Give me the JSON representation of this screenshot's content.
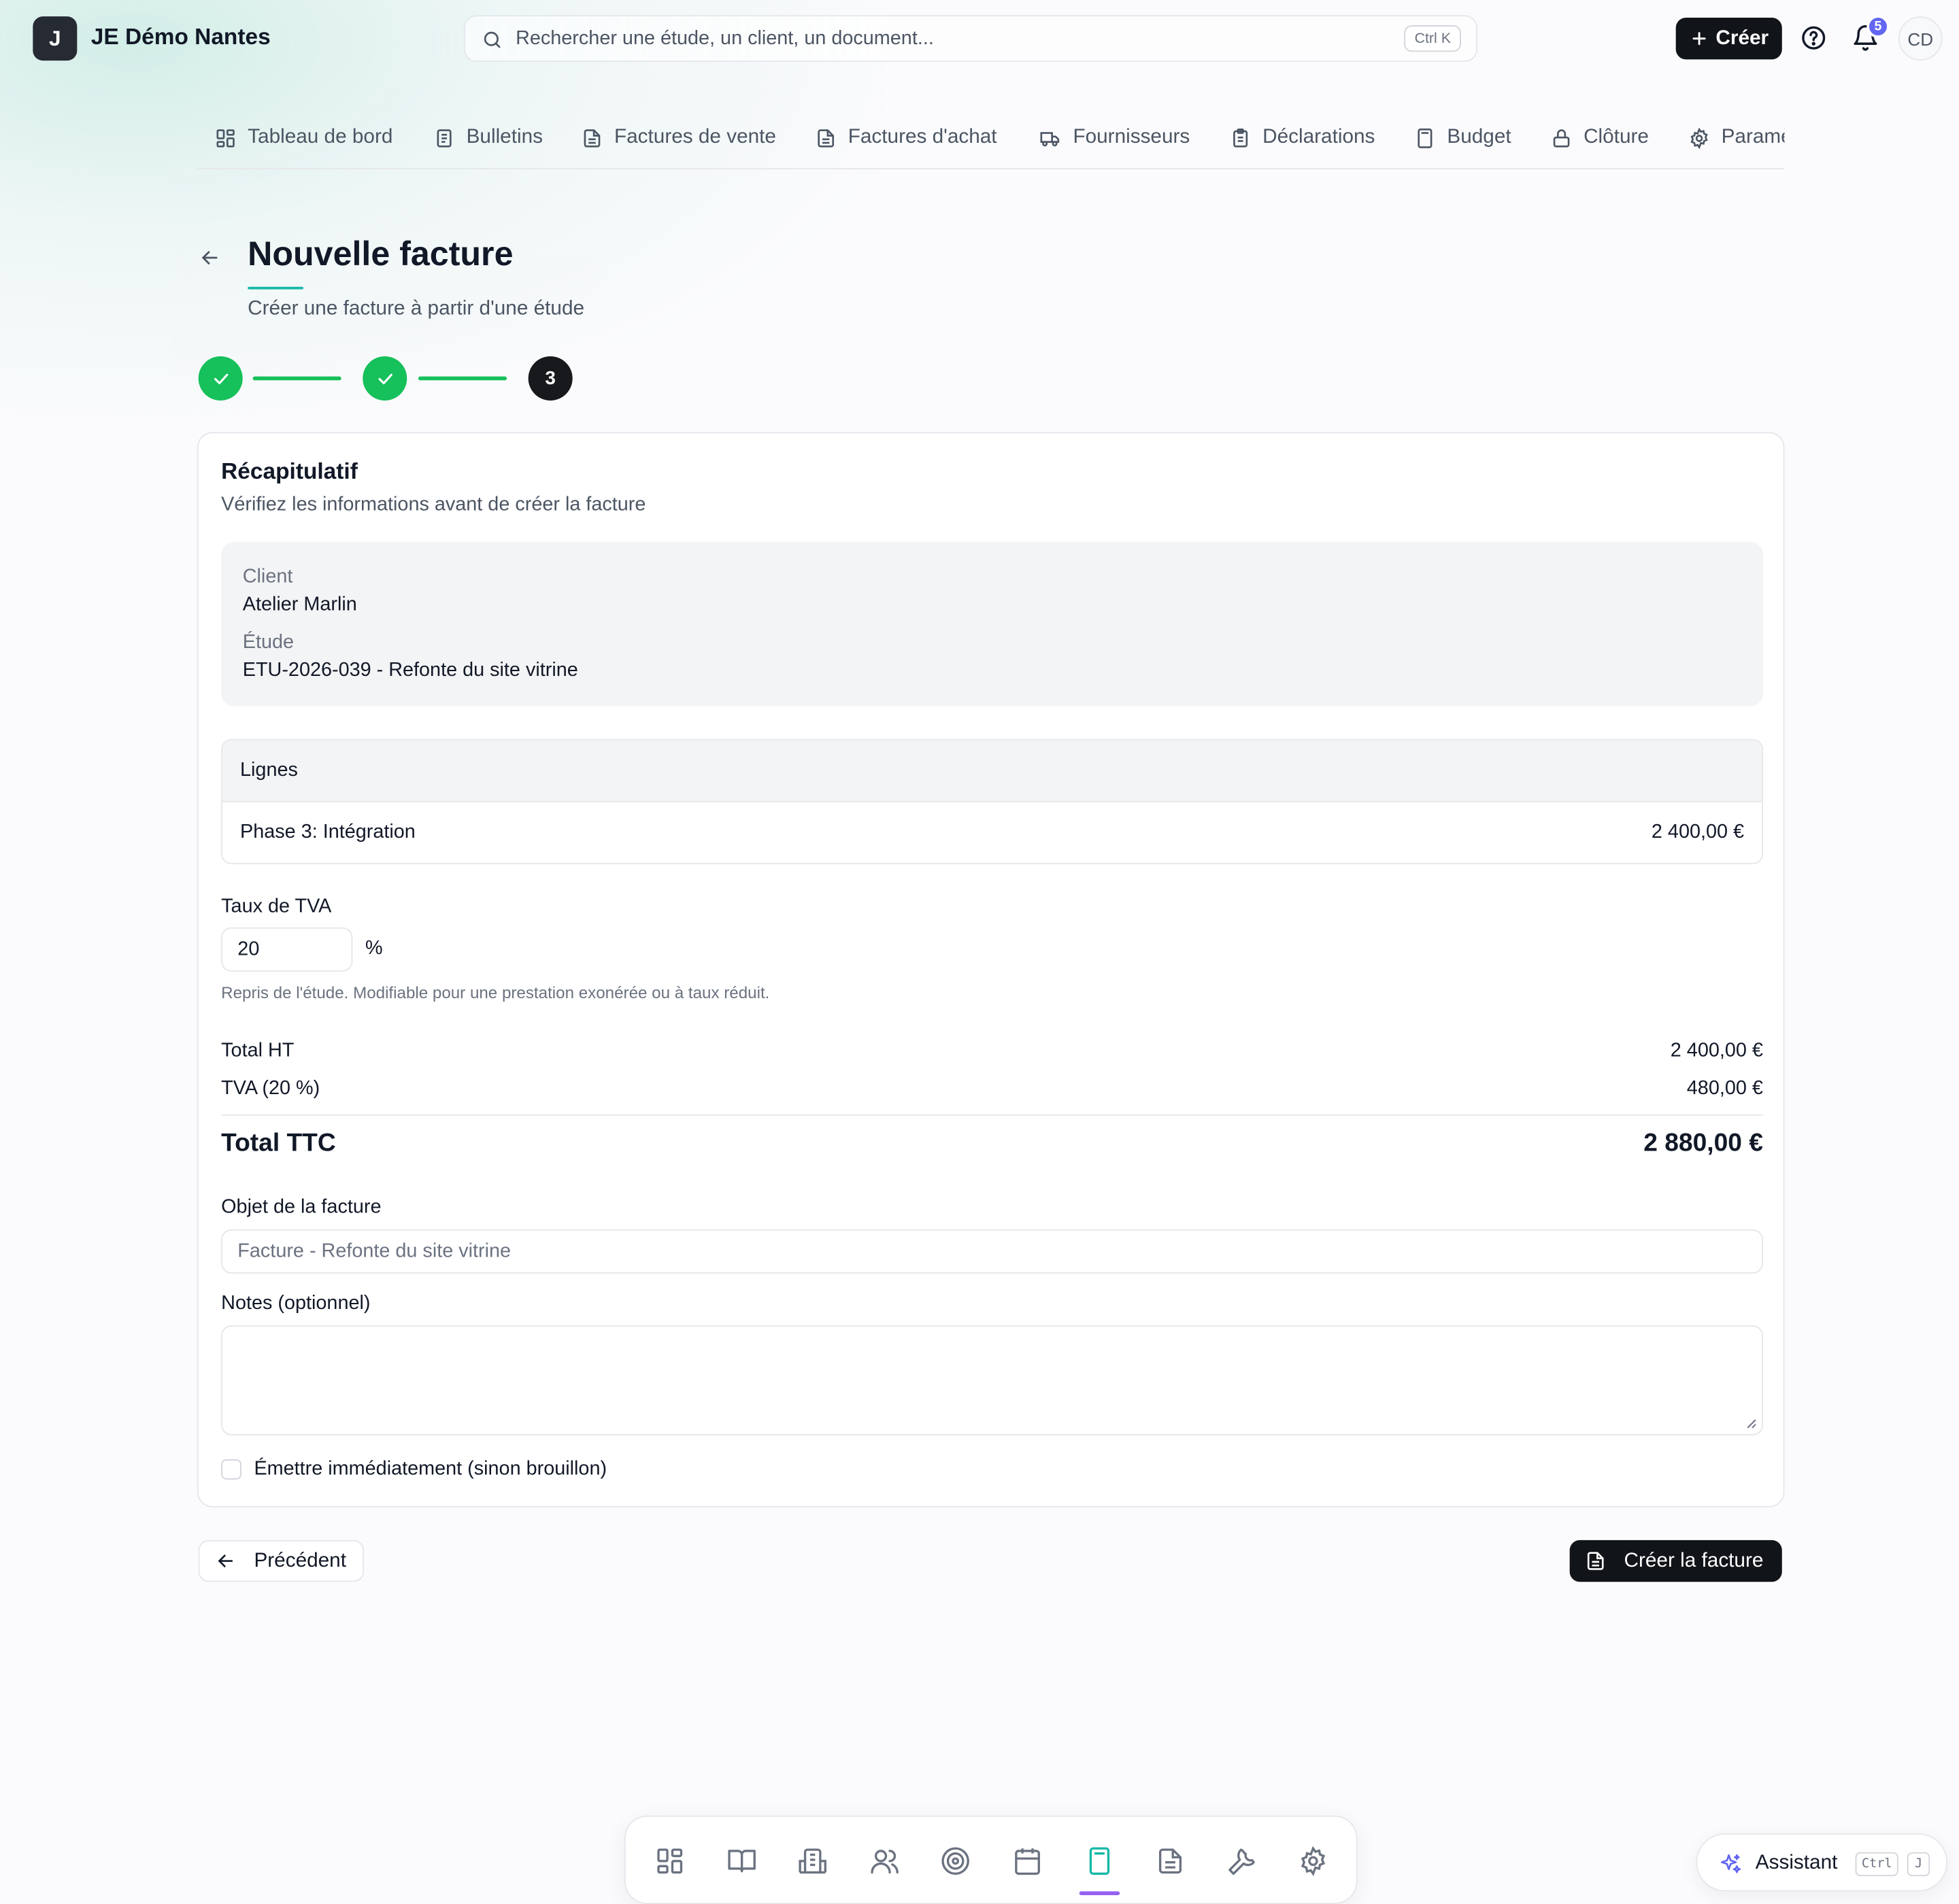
{
  "app": {
    "logo_letter": "J",
    "title": "JE Démo Nantes"
  },
  "search": {
    "placeholder": "Rechercher une étude, un client, un document...",
    "shortcut": "Ctrl K"
  },
  "header_actions": {
    "create_label": "Créer",
    "notifications_count": "5",
    "avatar_initials": "CD"
  },
  "nav_tabs": [
    {
      "label": "Tableau de bord",
      "icon": "dashboard-icon"
    },
    {
      "label": "Bulletins",
      "icon": "document-icon"
    },
    {
      "label": "Factures de vente",
      "icon": "invoice-icon"
    },
    {
      "label": "Factures d'achat",
      "icon": "invoice-icon"
    },
    {
      "label": "Fournisseurs",
      "icon": "truck-icon"
    },
    {
      "label": "Déclarations",
      "icon": "clipboard-icon"
    },
    {
      "label": "Budget",
      "icon": "calculator-icon"
    },
    {
      "label": "Clôture",
      "icon": "lock-icon"
    },
    {
      "label": "Paramètres",
      "icon": "gear-icon"
    }
  ],
  "page": {
    "title": "Nouvelle facture",
    "subtitle": "Créer une facture à partir d'une étude"
  },
  "stepper": {
    "steps": [
      "done",
      "done",
      "3"
    ],
    "current_label": "3"
  },
  "recap": {
    "title": "Récapitulatif",
    "subtitle": "Vérifiez les informations avant de créer la facture",
    "client_label": "Client",
    "client_value": "Atelier Marlin",
    "study_label": "Étude",
    "study_value": "ETU-2026-039 - Refonte du site vitrine",
    "lines_header": "Lignes",
    "lines": [
      {
        "description": "Phase 3: Intégration",
        "amount": "2 400,00 €"
      }
    ],
    "tva_label": "Taux de TVA",
    "tva_value": "20",
    "tva_unit": "%",
    "tva_hint": "Repris de l'étude. Modifiable pour une prestation exonérée ou à taux réduit.",
    "total_ht_label": "Total HT",
    "total_ht_value": "2 400,00 €",
    "tva_amount_label": "TVA (20 %)",
    "tva_amount_value": "480,00 €",
    "total_ttc_label": "Total TTC",
    "total_ttc_value": "2 880,00 €",
    "object_label": "Objet de la facture",
    "object_value": "Facture - Refonte du site vitrine",
    "notes_label": "Notes (optionnel)",
    "notes_value": "",
    "emit_label": "Émettre immédiatement (sinon brouillon)",
    "emit_checked": false
  },
  "actions": {
    "previous_label": "Précédent",
    "submit_label": "Créer la facture"
  },
  "dock": {
    "items": [
      "dashboard-icon",
      "book-icon",
      "building-icon",
      "users-icon",
      "target-icon",
      "calendar-icon",
      "calculator-icon",
      "document-icon",
      "wrench-icon",
      "gear-icon"
    ],
    "active": "calculator-icon"
  },
  "assistant": {
    "label": "Assistant",
    "key1": "Ctrl",
    "key2": "J"
  },
  "colors": {
    "accent": "#16c05a",
    "dark": "#111418",
    "teal": "#14b8a6",
    "badge": "#6366f1"
  }
}
